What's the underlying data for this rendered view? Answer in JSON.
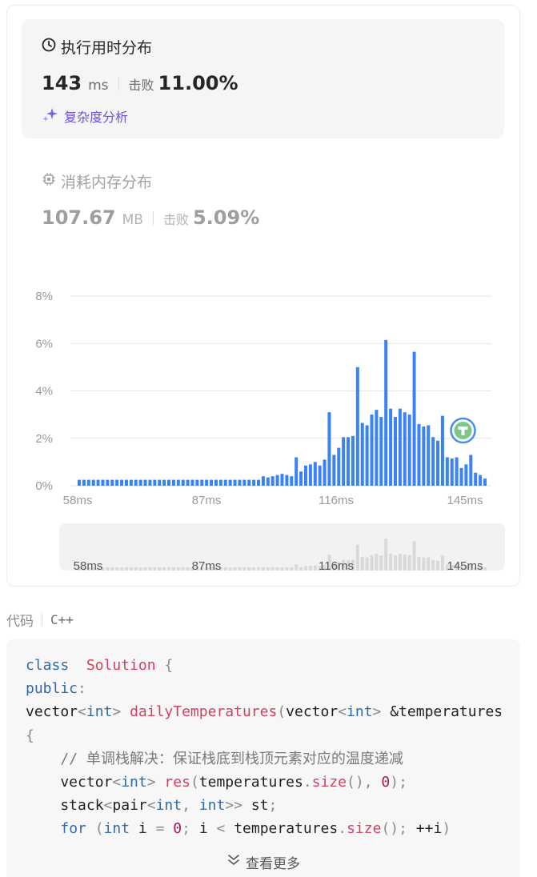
{
  "runtime": {
    "title": "执行用时分布",
    "value": "143",
    "unit": "ms",
    "beats_label": "击败",
    "beats_value": "11.00%",
    "analysis_label": "复杂度分析"
  },
  "memory": {
    "title": "消耗内存分布",
    "value": "107.67",
    "unit": "MB",
    "beats_label": "击败",
    "beats_value": "5.09%"
  },
  "chart_data": {
    "type": "bar",
    "x_unit": "ms",
    "x_ticks": [
      "58ms",
      "87ms",
      "116ms",
      "145ms"
    ],
    "y_ticks": [
      "0%",
      "2%",
      "4%",
      "6%",
      "8%"
    ],
    "ylim": [
      0,
      8
    ],
    "grid": true,
    "colors": {
      "bar": "#3b82f6",
      "nav_bar": "#d9d9d9",
      "grid": "#e6e6e6",
      "marker": "#4a8ee6",
      "marker_fill": "#7dc78a"
    },
    "values": [
      0.25,
      0.25,
      0.25,
      0.25,
      0.25,
      0.25,
      0.25,
      0.25,
      0.25,
      0.25,
      0.25,
      0.25,
      0.25,
      0.25,
      0.25,
      0.25,
      0.25,
      0.25,
      0.25,
      0.25,
      0.25,
      0.25,
      0.25,
      0.25,
      0.25,
      0.25,
      0.25,
      0.25,
      0.25,
      0.25,
      0.25,
      0.25,
      0.25,
      0.25,
      0.25,
      0.25,
      0.25,
      0.25,
      0.25,
      0.4,
      0.35,
      0.4,
      0.45,
      0.5,
      0.45,
      0.4,
      1.2,
      0.6,
      0.85,
      0.9,
      1.0,
      0.85,
      1.1,
      3.1,
      1.3,
      1.6,
      2.05,
      2.05,
      2.1,
      5.0,
      2.65,
      2.55,
      3.0,
      3.2,
      2.9,
      6.15,
      3.25,
      2.9,
      3.25,
      3.1,
      3.0,
      5.65,
      2.6,
      2.5,
      2.55,
      2.05,
      1.9,
      2.95,
      1.2,
      1.15,
      1.2,
      0.75,
      0.9,
      1.3,
      0.55,
      0.45,
      0.3
    ],
    "marker_index": 81
  },
  "code": {
    "language_label": "代码",
    "language": "C++",
    "view_more_label": "查看更多",
    "lines": [
      [
        [
          "kw",
          "class"
        ],
        [
          "",
          "  "
        ],
        [
          "cls",
          "Solution"
        ],
        [
          "pn",
          " {"
        ]
      ],
      [
        [
          "kw",
          "public"
        ],
        [
          "pn",
          ":"
        ]
      ],
      [
        [
          "",
          "vector"
        ],
        [
          "pn",
          "<"
        ],
        [
          "ty",
          "int"
        ],
        [
          "pn",
          "> "
        ],
        [
          "fn",
          "dailyTemperatures"
        ],
        [
          "pn",
          "("
        ],
        [
          "",
          "vector"
        ],
        [
          "pn",
          "<"
        ],
        [
          "ty",
          "int"
        ],
        [
          "pn",
          "> "
        ],
        [
          "",
          "&temperatures"
        ]
      ],
      [
        [
          "pn",
          "{"
        ]
      ],
      [
        [
          "",
          "    "
        ],
        [
          "cm",
          "// 单调栈解决：保证栈底到栈顶元素对应的温度递减"
        ]
      ],
      [
        [
          "",
          "    vector"
        ],
        [
          "pn",
          "<"
        ],
        [
          "ty",
          "int"
        ],
        [
          "pn",
          "> "
        ],
        [
          "fn",
          "res"
        ],
        [
          "pn",
          "("
        ],
        [
          "",
          "temperatures"
        ],
        [
          "pn",
          "."
        ],
        [
          "fn",
          "size"
        ],
        [
          "pn",
          "(), "
        ],
        [
          "num",
          "0"
        ],
        [
          "pn",
          ");"
        ]
      ],
      [
        [
          "",
          "    stack"
        ],
        [
          "pn",
          "<"
        ],
        [
          "",
          "pair"
        ],
        [
          "pn",
          "<"
        ],
        [
          "ty",
          "int"
        ],
        [
          "pn",
          ", "
        ],
        [
          "ty",
          "int"
        ],
        [
          "pn",
          ">> "
        ],
        [
          "",
          "st"
        ],
        [
          "pn",
          ";"
        ]
      ],
      [
        [
          "",
          "    "
        ],
        [
          "kw",
          "for"
        ],
        [
          "pn",
          " ("
        ],
        [
          "ty",
          "int"
        ],
        [
          "",
          ""
        ],
        [
          "",
          " i "
        ],
        [
          "pn",
          "= "
        ],
        [
          "num",
          "0"
        ],
        [
          "pn",
          "; "
        ],
        [
          "",
          "i "
        ],
        [
          "pn",
          "< "
        ],
        [
          "",
          "temperatures"
        ],
        [
          "pn",
          "."
        ],
        [
          "fn",
          "size"
        ],
        [
          "pn",
          "(); "
        ],
        [
          "",
          "++i"
        ],
        [
          "pn",
          ")"
        ]
      ]
    ]
  }
}
